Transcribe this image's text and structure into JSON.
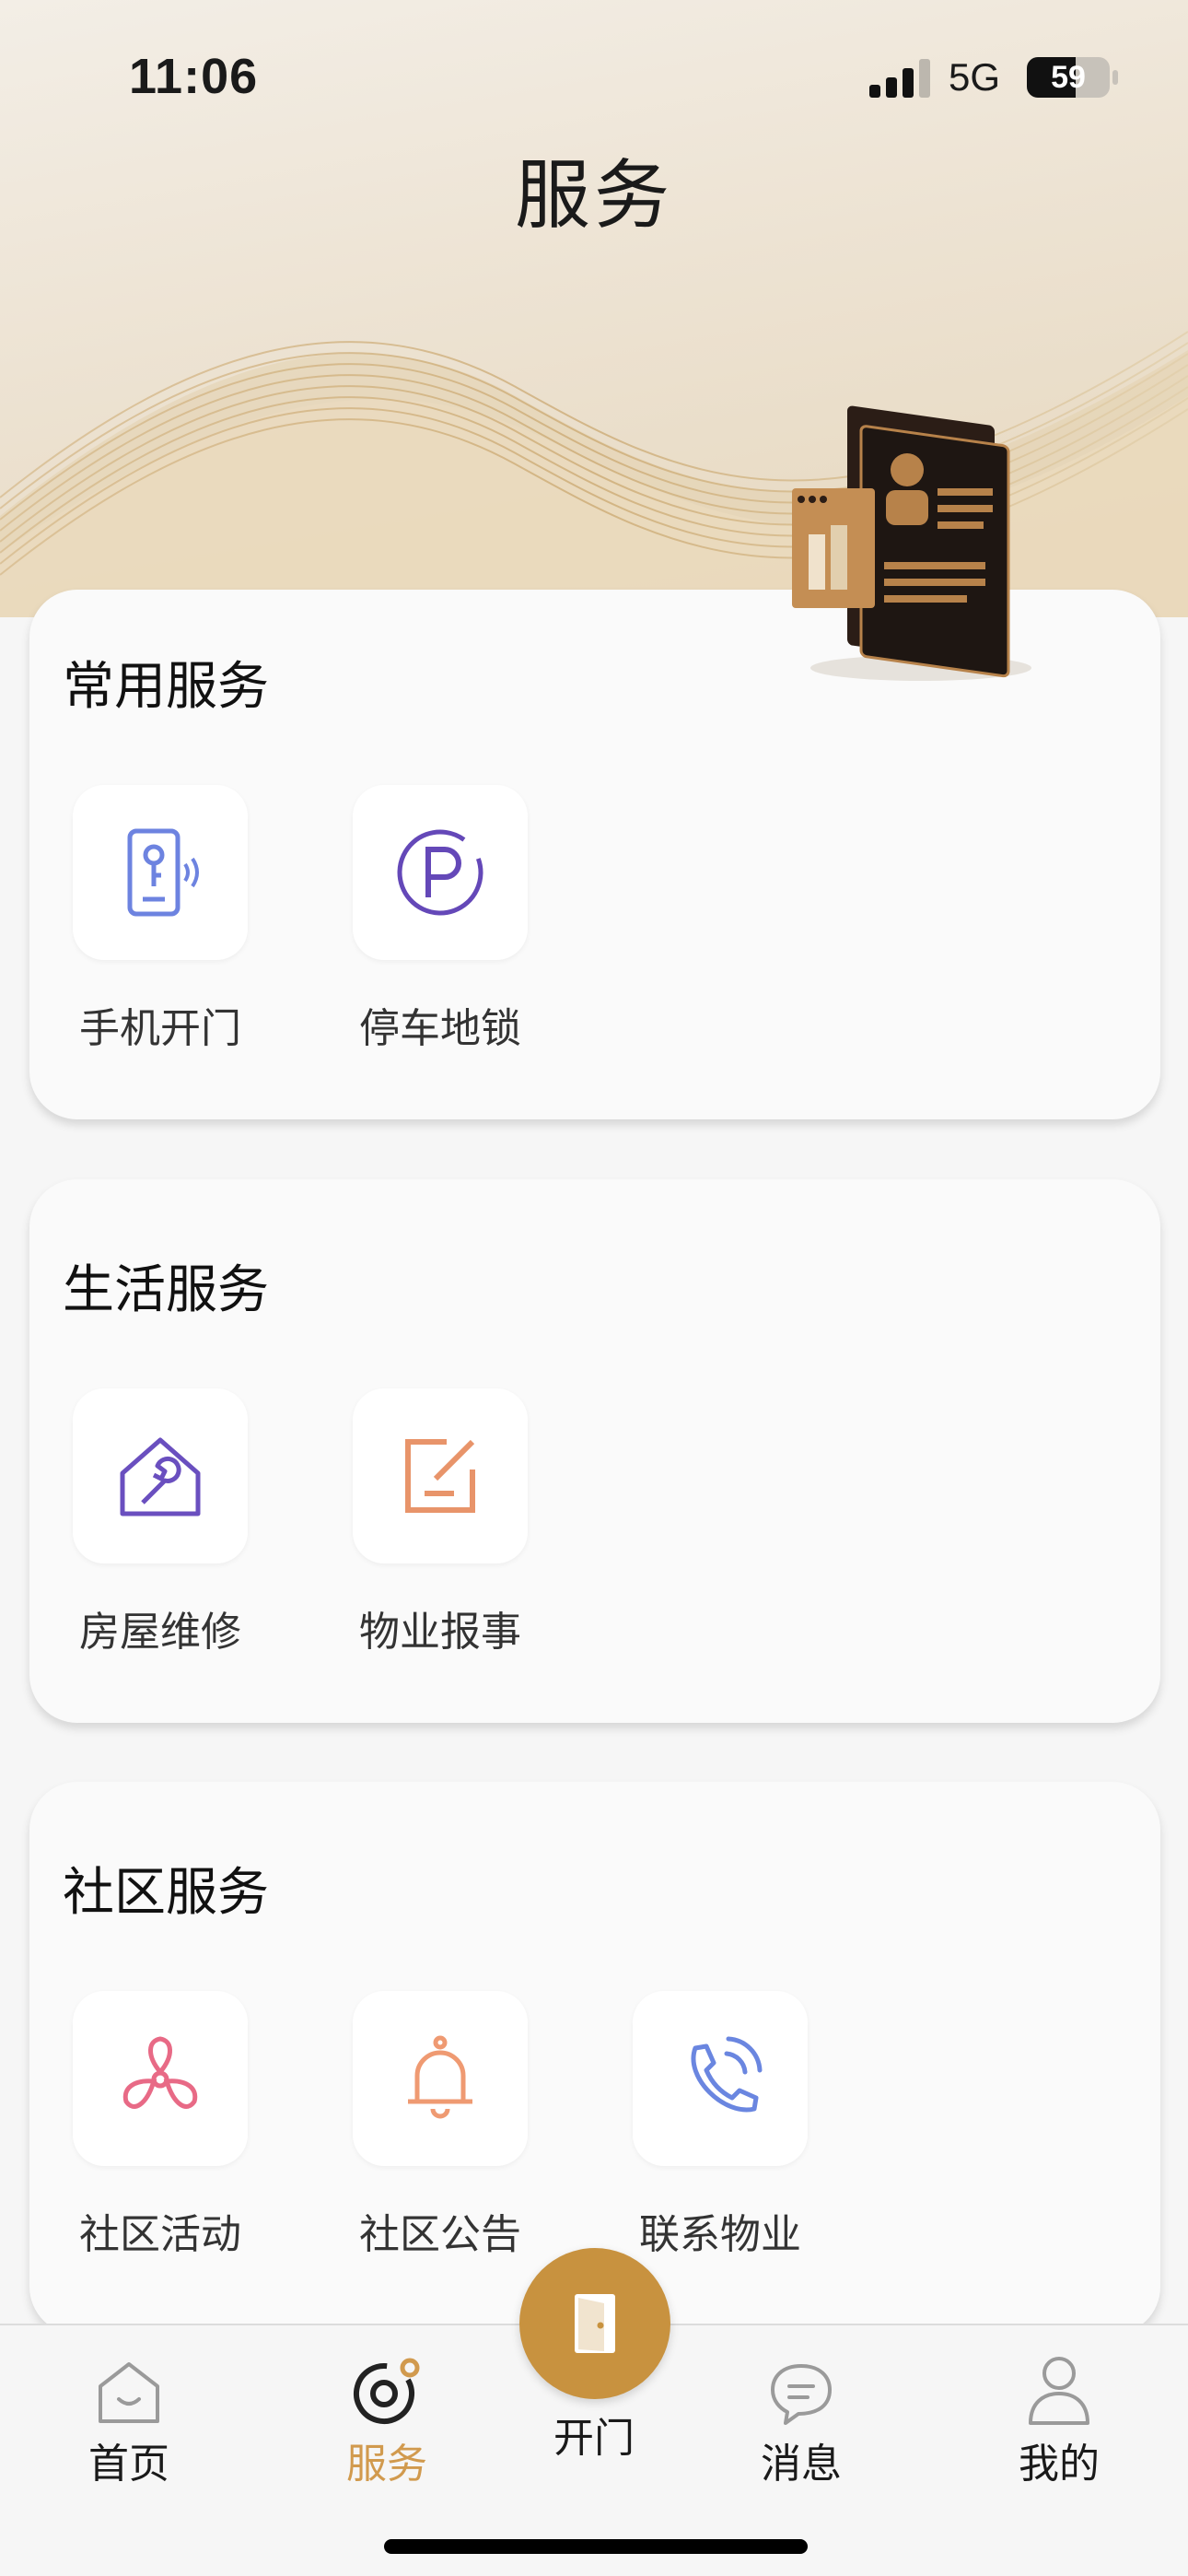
{
  "status_bar": {
    "time": "11:06",
    "network": "5G",
    "battery": "59",
    "battery_level": 0.59
  },
  "header": {
    "title": "服务"
  },
  "sections": [
    {
      "title": "常用服务",
      "items": [
        {
          "label": "手机开门",
          "icon": "phone-key-icon",
          "color": "#6d83e0"
        },
        {
          "label": "停车地锁",
          "icon": "parking-icon",
          "color": "#6448b8"
        }
      ]
    },
    {
      "title": "生活服务",
      "items": [
        {
          "label": "房屋维修",
          "icon": "house-wrench-icon",
          "color": "#6a4fbf"
        },
        {
          "label": "物业报事",
          "icon": "edit-report-icon",
          "color": "#e8946a"
        }
      ]
    },
    {
      "title": "社区服务",
      "items": [
        {
          "label": "社区活动",
          "icon": "pinwheel-icon",
          "color": "#e86a86"
        },
        {
          "label": "社区公告",
          "icon": "bell-icon",
          "color": "#ef9a72"
        },
        {
          "label": "联系物业",
          "icon": "phone-call-icon",
          "color": "#6a86e0"
        }
      ]
    }
  ],
  "tabbar": {
    "items": [
      {
        "label": "首页",
        "icon": "home-icon"
      },
      {
        "label": "服务",
        "icon": "service-icon",
        "active": true
      },
      {
        "label": "开门",
        "icon": "door-icon"
      },
      {
        "label": "消息",
        "icon": "message-icon"
      },
      {
        "label": "我的",
        "icon": "profile-icon"
      }
    ],
    "accent_color": "#c8923f"
  }
}
